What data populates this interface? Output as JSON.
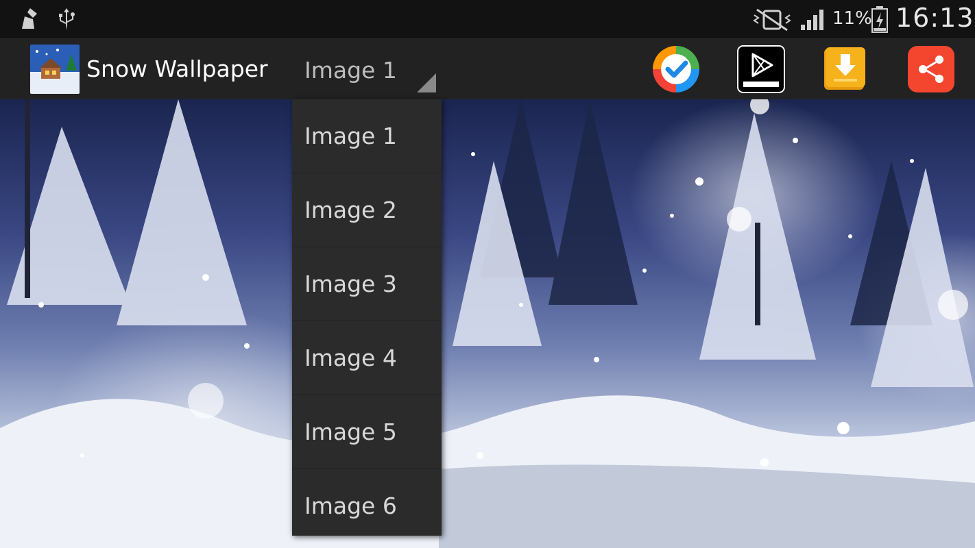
{
  "status_bar": {
    "battery_percent": "11%",
    "time": "16:13",
    "icons": [
      "cleaner-icon",
      "usb-icon",
      "mute-icon",
      "signal-icon",
      "battery-charging-icon"
    ]
  },
  "action_bar": {
    "app_title": "Snow Wallpaper",
    "spinner_value": "Image 1",
    "buttons": [
      "check-app-icon",
      "google-play-icon",
      "download-icon",
      "share-icon"
    ]
  },
  "dropdown": {
    "items": [
      "Image 1",
      "Image 2",
      "Image 3",
      "Image 4",
      "Image 5",
      "Image 6"
    ]
  },
  "colors": {
    "action_bar_bg": "#222222",
    "dropdown_bg": "#2b2b2b",
    "download_yellow": "#f6b21b",
    "share_red": "#f4462f"
  }
}
